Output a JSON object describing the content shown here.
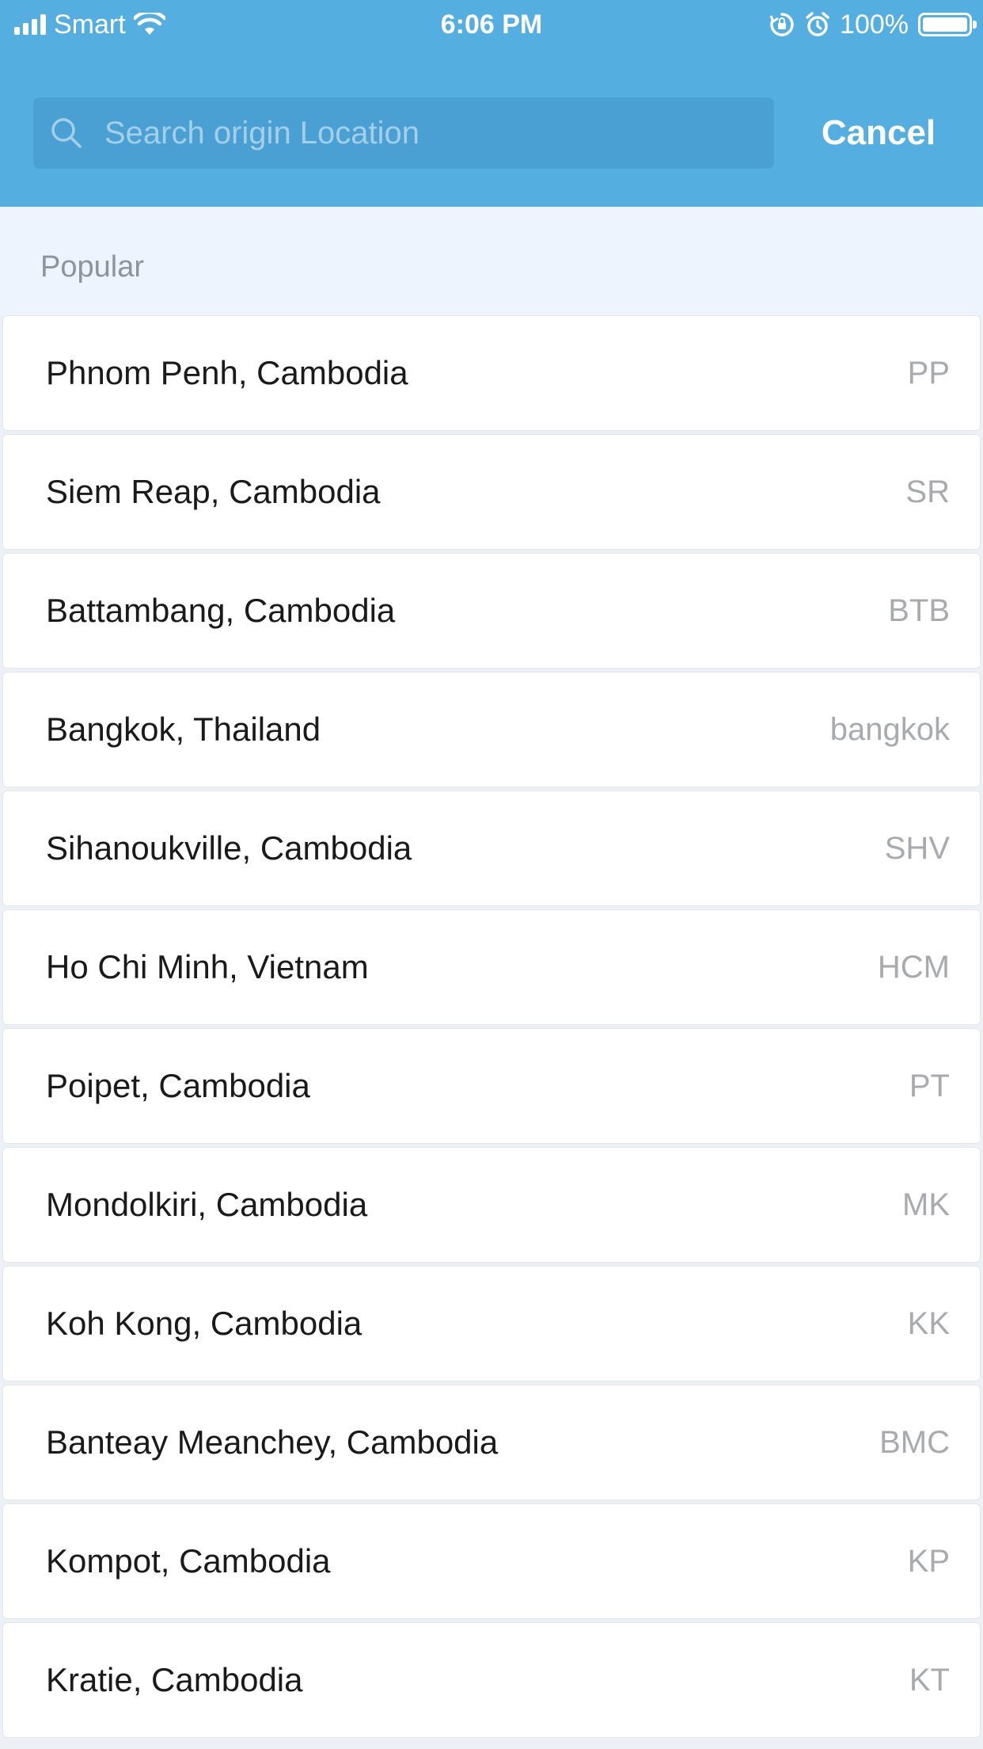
{
  "status_bar": {
    "carrier": "Smart",
    "time": "6:06 PM",
    "battery_percent": "100%",
    "battery_level": 1.0,
    "icons": [
      "signal-icon",
      "wifi-icon",
      "rotation-lock-icon",
      "alarm-icon",
      "battery-icon"
    ]
  },
  "search": {
    "placeholder": "Search origin Location",
    "value": "",
    "cancel_label": "Cancel",
    "icon": "search-icon"
  },
  "section": {
    "title": "Popular"
  },
  "locations": [
    {
      "name": "Phnom Penh, Cambodia",
      "code": "PP"
    },
    {
      "name": "Siem Reap, Cambodia",
      "code": "SR"
    },
    {
      "name": "Battambang, Cambodia",
      "code": "BTB"
    },
    {
      "name": "Bangkok, Thailand",
      "code": "bangkok"
    },
    {
      "name": "Sihanoukville, Cambodia",
      "code": "SHV"
    },
    {
      "name": "Ho Chi Minh, Vietnam",
      "code": "HCM"
    },
    {
      "name": "Poipet, Cambodia",
      "code": "PT"
    },
    {
      "name": "Mondolkiri, Cambodia",
      "code": "MK"
    },
    {
      "name": "Koh Kong, Cambodia",
      "code": "KK"
    },
    {
      "name": "Banteay Meanchey, Cambodia",
      "code": "BMC"
    },
    {
      "name": "Kompot, Cambodia",
      "code": "KP"
    },
    {
      "name": "Kratie, Cambodia",
      "code": "KT"
    }
  ],
  "colors": {
    "header_blue": "#54aee0",
    "search_field": "#4aa0d3",
    "section_bg": "#edf4fd",
    "code_gray": "#a8aaad"
  }
}
